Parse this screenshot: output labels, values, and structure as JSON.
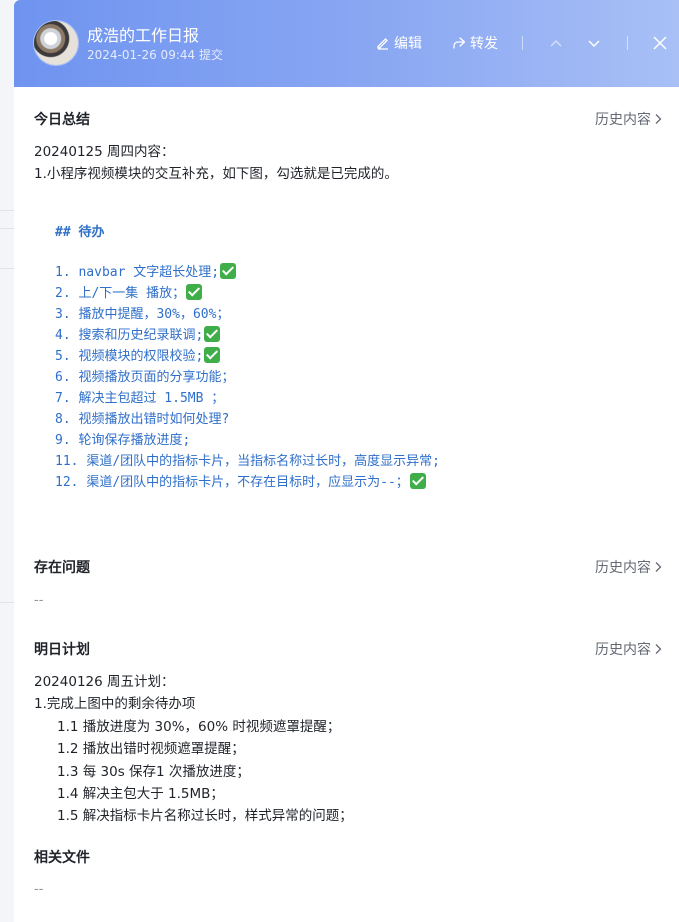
{
  "header": {
    "title": "成浩的工作日报",
    "submitted": "2024-01-26 09:44 提交",
    "edit_label": "编辑",
    "forward_label": "转发"
  },
  "sections": {
    "summary": {
      "title": "今日总结",
      "history_label": "历史内容",
      "line1": "20240125 周四内容：",
      "line2": "1.小程序视频模块的交互补充，如下图，勾选就是已完成的。",
      "todo_heading": "## 待办",
      "todos": [
        {
          "num": "1.",
          "text": "navbar 文字超长处理;",
          "done": true
        },
        {
          "num": "2.",
          "text": "上/下一集 播放；",
          "done": true
        },
        {
          "num": "3.",
          "text": "播放中提醒，30%，60%；",
          "done": false
        },
        {
          "num": "4.",
          "text": "搜索和历史纪录联调;",
          "done": true
        },
        {
          "num": "5.",
          "text": "视频模块的权限校验;",
          "done": true
        },
        {
          "num": "6.",
          "text": "视频播放页面的分享功能；",
          "done": false
        },
        {
          "num": "7.",
          "text": "解决主包超过 1.5MB ；",
          "done": false
        },
        {
          "num": "8.",
          "text": "视频播放出错时如何处理?",
          "done": false
        },
        {
          "num": "9.",
          "text": "轮询保存播放进度;",
          "done": false
        },
        {
          "num": "11.",
          "text": "渠道/团队中的指标卡片，当指标名称过长时，高度显示异常;",
          "done": false
        },
        {
          "num": "12.",
          "text": "渠道/团队中的指标卡片，不存在目标时，应显示为--；",
          "done": true
        }
      ]
    },
    "issues": {
      "title": "存在问题",
      "history_label": "历史内容",
      "value": "--"
    },
    "plan": {
      "title": "明日计划",
      "history_label": "历史内容",
      "line1": "20240126 周五计划：",
      "line2": "1.完成上图中的剩余待办项",
      "items": [
        "1.1 播放进度为 30%，60% 时视频遮罩提醒；",
        "1.2 播放出错时视频遮罩提醒；",
        "1.3 每 30s 保存1 次播放进度；",
        "1.4 解决主包大于 1.5MB；",
        "1.5 解决指标卡片名称过长时，样式异常的问题；"
      ]
    },
    "files": {
      "title": "相关文件",
      "value": "--"
    }
  },
  "colors": {
    "header_gradient_start": "#6f94f0",
    "header_gradient_end": "#a8c0f6",
    "todo_text": "#2f6fc9",
    "check_green": "#3fae49"
  }
}
